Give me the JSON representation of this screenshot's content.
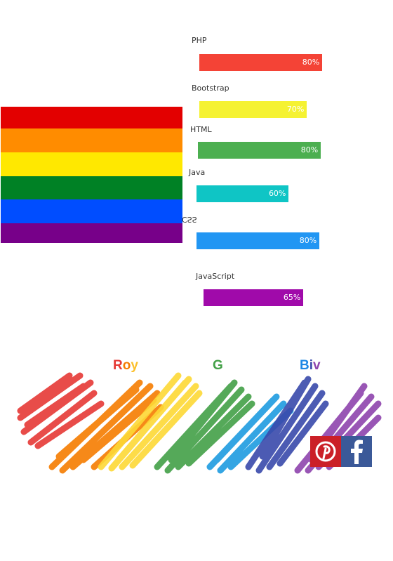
{
  "flag": {
    "colors": [
      "#e30000",
      "#ff8c00",
      "#ffe800",
      "#008125",
      "#004dff",
      "#770089"
    ]
  },
  "skills": [
    {
      "label": "PHP",
      "percent": 80,
      "percent_text": "80%",
      "color": "#f44336"
    },
    {
      "label": "Bootstrap",
      "percent": 70,
      "percent_text": "70%",
      "color": "#f5f232"
    },
    {
      "label": "HTML",
      "percent": 80,
      "percent_text": "80%",
      "color": "#4caf50"
    },
    {
      "label": "Java",
      "percent": 60,
      "percent_text": "60%",
      "color": "#0fc5c5"
    },
    {
      "label": "CSS",
      "percent": 80,
      "percent_text": "80%",
      "color": "#2196f3"
    },
    {
      "label": "JavaScript",
      "percent": 65,
      "percent_text": "65%",
      "color": "#a00aaa"
    }
  ],
  "banner": {
    "roy": {
      "r": "R",
      "o": "o",
      "y": "y"
    },
    "g": "G",
    "biv": {
      "b": "B",
      "i": "i",
      "v": "v"
    },
    "colors": {
      "red": "#e53935",
      "orange": "#f57c00",
      "yellow": "#fbc02d",
      "green": "#43a047",
      "blue": "#1e88e5",
      "indigo": "#3949ab",
      "violet": "#8e44ad"
    }
  },
  "social": {
    "pinterest_icon": "pinterest-icon",
    "facebook_icon": "facebook-icon",
    "pinterest_color": "#cb2027",
    "facebook_color": "#3b5998"
  }
}
